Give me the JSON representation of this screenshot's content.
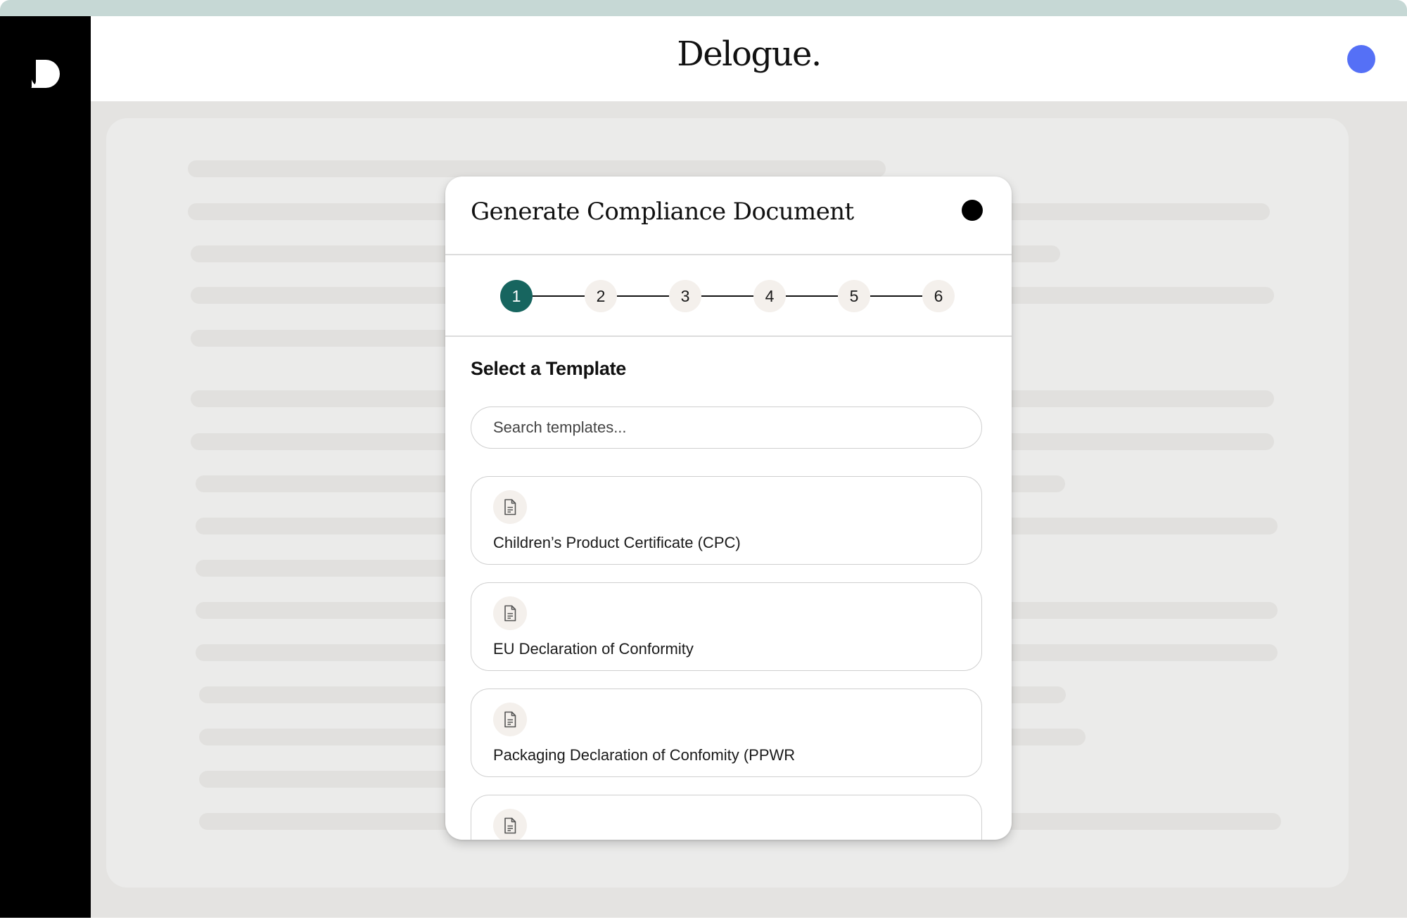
{
  "app": {
    "brand": "Delogue.",
    "colors": {
      "sidebar": "#000000",
      "accent_step": "#17655f",
      "avatar": "#5570f6",
      "top_strip": "#c6d8d5"
    }
  },
  "modal": {
    "title": "Generate Compliance Document",
    "steps": [
      "1",
      "2",
      "3",
      "4",
      "5",
      "6"
    ],
    "active_step": "1",
    "section_title": "Select a Template",
    "search_placeholder": "Search templates...",
    "templates": [
      {
        "label": "Children’s Product Certificate (CPC)",
        "icon": "document-icon"
      },
      {
        "label": "EU Declaration of Conformity",
        "icon": "document-icon"
      },
      {
        "label": "Packaging Declaration of Confomity (PPWR",
        "icon": "document-icon"
      },
      {
        "label": "",
        "icon": "document-icon"
      }
    ]
  }
}
